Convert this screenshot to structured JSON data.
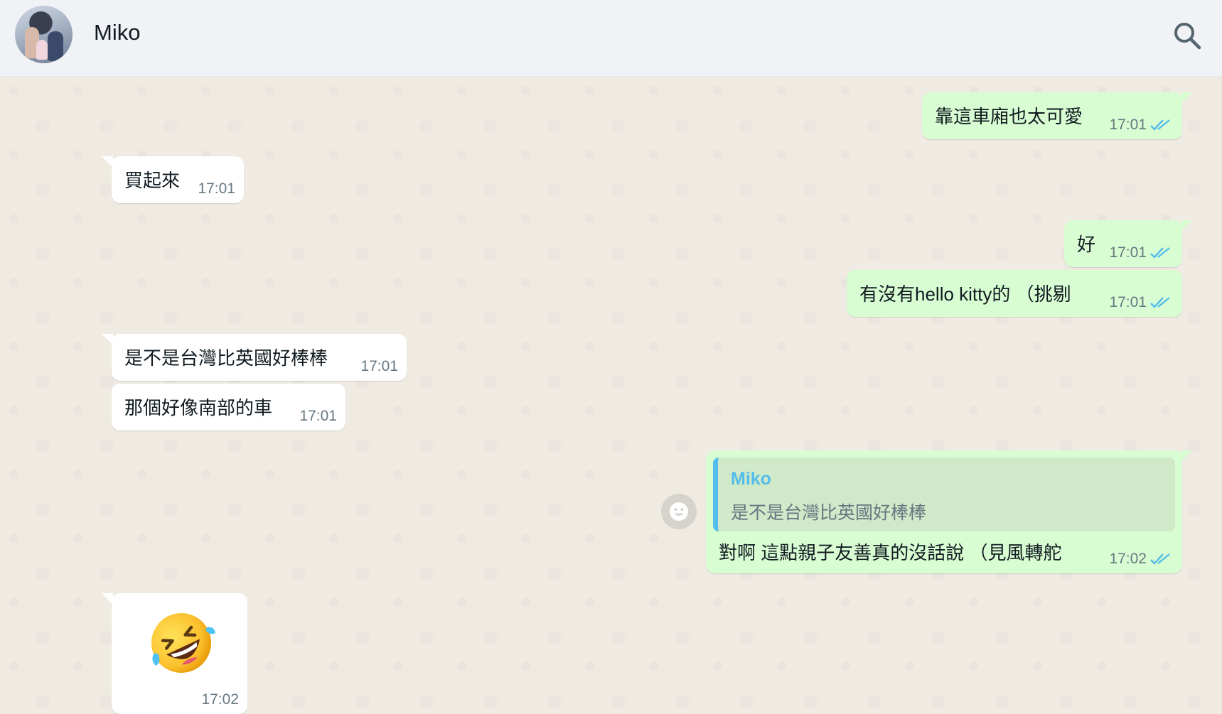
{
  "header": {
    "contact_name": "Miko",
    "search_icon": "search-icon",
    "avatar_icon": "avatar"
  },
  "colors": {
    "header_bg": "#f0f2f5",
    "chat_bg": "#efeae2",
    "incoming_bubble": "#ffffff",
    "outgoing_bubble": "#d9fdd3",
    "read_tick": "#53bdeb",
    "reply_accent": "#53bdeb"
  },
  "messages": [
    {
      "direction": "out",
      "text": "靠這車廂也太可愛",
      "time": "17:01",
      "status": "read"
    },
    {
      "direction": "in",
      "text": "買起來",
      "time": "17:01"
    },
    {
      "direction": "out",
      "text": "好",
      "time": "17:01",
      "status": "read"
    },
    {
      "direction": "out",
      "text": "有沒有hello kitty的 （挑剔",
      "time": "17:01",
      "status": "read"
    },
    {
      "direction": "in",
      "text": "是不是台灣比英國好棒棒",
      "time": "17:01"
    },
    {
      "direction": "in",
      "text": "那個好像南部的車",
      "time": "17:01"
    },
    {
      "direction": "out",
      "reply_author": "Miko",
      "reply_text": "是不是台灣比英國好棒棒",
      "text": "對啊 這點親子友善真的沒話說 （見風轉舵",
      "time": "17:02",
      "status": "read"
    },
    {
      "direction": "in",
      "emoji": "rolling-on-the-floor-laughing",
      "time": "17:02"
    }
  ]
}
